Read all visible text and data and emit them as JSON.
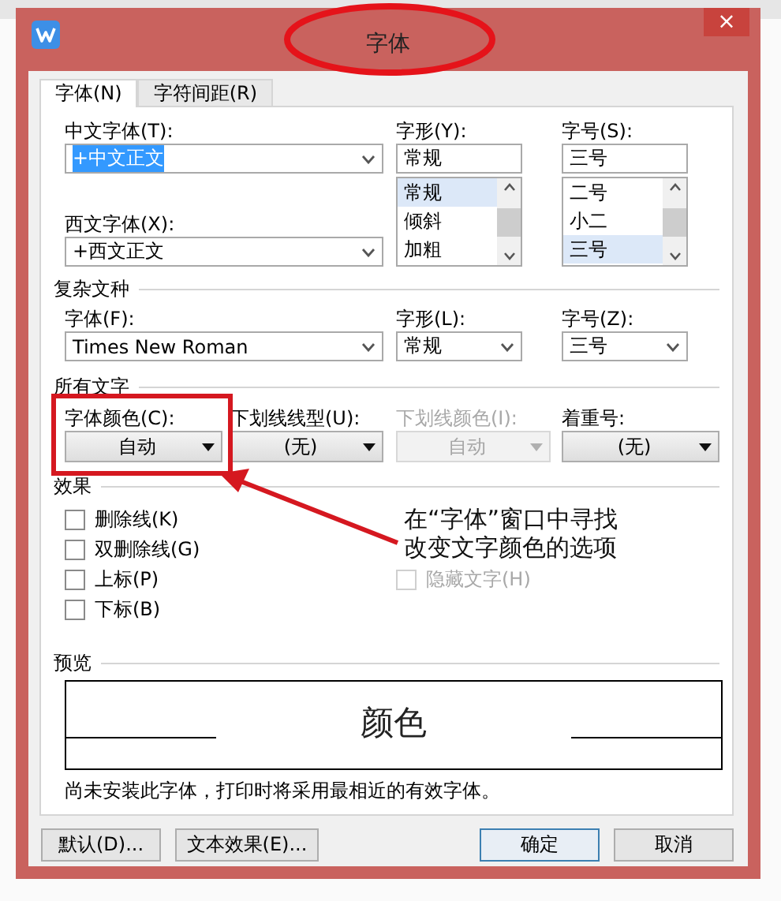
{
  "window": {
    "title": "字体",
    "close": "×"
  },
  "tabs": [
    {
      "label": "字体(N)",
      "selected": true
    },
    {
      "label": "字符间距(R)",
      "selected": false
    }
  ],
  "chinese_font": {
    "label": "中文字体(T):",
    "value": "+中文正文",
    "text_selected": true
  },
  "western_font": {
    "label": "西文字体(X):",
    "value": "+西文正文",
    "text_selected": false
  },
  "style": {
    "label": "字形(Y):",
    "value": "常规",
    "options": [
      {
        "label": "常规",
        "selected": true
      },
      {
        "label": "倾斜",
        "selected": false
      },
      {
        "label": "加粗",
        "selected": false
      }
    ]
  },
  "size": {
    "label": "字号(S):",
    "value": "三号",
    "options": [
      {
        "label": "二号",
        "selected": false
      },
      {
        "label": "小二",
        "selected": false
      },
      {
        "label": "三号",
        "selected": true
      }
    ]
  },
  "complex_script": {
    "heading": "复杂文种",
    "fields": [
      {
        "label": "字体(F):",
        "value": "Times New Roman"
      },
      {
        "label": "字形(L):",
        "value": "常规"
      },
      {
        "label": "字号(Z):",
        "value": "三号"
      }
    ]
  },
  "all_text": {
    "heading": "所有文字",
    "fields": [
      {
        "label": "字体颜色(C):",
        "value": "自动",
        "disabled": false
      },
      {
        "label": "下划线线型(U):",
        "value": "(无)",
        "disabled": false
      },
      {
        "label": "下划线颜色(I):",
        "value": "自动",
        "disabled": true
      },
      {
        "label": "着重号:",
        "value": "(无)",
        "disabled": false
      }
    ]
  },
  "effects": {
    "heading": "效果",
    "left_items": [
      {
        "label": "删除线(K)",
        "checked": false,
        "disabled": false
      },
      {
        "label": "双删除线(G)",
        "checked": false,
        "disabled": false
      },
      {
        "label": "上标(P)",
        "checked": false,
        "disabled": false
      },
      {
        "label": "下标(B)",
        "checked": false,
        "disabled": false
      }
    ],
    "right_items": [
      {
        "label": "隐藏文字(H)",
        "checked": false,
        "disabled": true
      }
    ]
  },
  "preview": {
    "heading": "预览",
    "sample": "颜色",
    "note": "尚未安装此字体，打印时将采用最相近的有效字体。"
  },
  "buttons": [
    {
      "label": "默认(D)...",
      "kind": "plain"
    },
    {
      "label": "文本效果(E)...",
      "kind": "plain"
    },
    {
      "label": "确定",
      "kind": "default"
    },
    {
      "label": "取消",
      "kind": "plain"
    }
  ],
  "annotation": {
    "lines": [
      "在“字体”窗口中寻找",
      "改变文字颜色的选项"
    ]
  }
}
